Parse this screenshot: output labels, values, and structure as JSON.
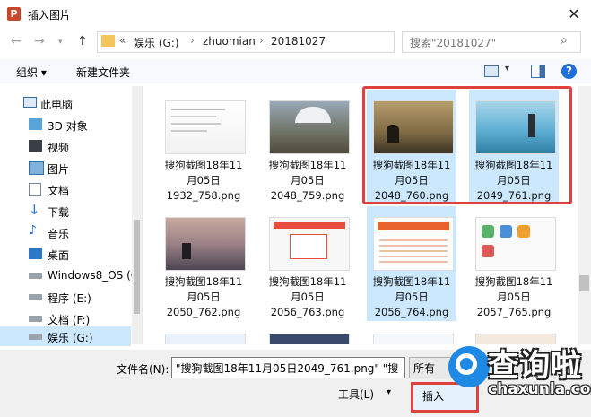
{
  "window": {
    "title": "插入图片",
    "app_icon": "P",
    "close_glyph": "✕"
  },
  "address": {
    "chevron": "«",
    "crumbs": [
      "娱乐 (G:)",
      "zhuomian",
      "20181027"
    ],
    "search_placeholder": "搜索\"20181027\""
  },
  "toolbar": {
    "organize": "组织 ▾",
    "new_folder": "新建文件夹"
  },
  "nav": {
    "items": [
      {
        "label": "此电脑",
        "icon": "computer-icon"
      },
      {
        "label": "3D 对象",
        "icon": "3d-objects-icon"
      },
      {
        "label": "视频",
        "icon": "video-icon"
      },
      {
        "label": "图片",
        "icon": "pictures-icon"
      },
      {
        "label": "文档",
        "icon": "documents-icon"
      },
      {
        "label": "下载",
        "icon": "download-icon"
      },
      {
        "label": "音乐",
        "icon": "music-icon"
      },
      {
        "label": "桌面",
        "icon": "desktop-icon"
      },
      {
        "label": "Windows8_OS (C",
        "icon": "drive-icon"
      },
      {
        "label": "程序 (E:)",
        "icon": "drive-icon"
      },
      {
        "label": "文档 (F:)",
        "icon": "drive-icon"
      },
      {
        "label": "娱乐 (G:)",
        "icon": "drive-icon"
      }
    ]
  },
  "files": [
    {
      "l1": "搜狗截图18年11",
      "l2": "月05日",
      "l3": "1932_758.png"
    },
    {
      "l1": "搜狗截图18年11",
      "l2": "月05日",
      "l3": "2048_759.png"
    },
    {
      "l1": "搜狗截图18年11",
      "l2": "月05日",
      "l3": "2048_760.png"
    },
    {
      "l1": "搜狗截图18年11",
      "l2": "月05日",
      "l3": "2049_761.png"
    },
    {
      "l1": "搜狗截图18年11",
      "l2": "月05日",
      "l3": "2050_762.png"
    },
    {
      "l1": "搜狗截图18年11",
      "l2": "月05日",
      "l3": "2056_763.png"
    },
    {
      "l1": "搜狗截图18年11",
      "l2": "月05日",
      "l3": "2056_764.png"
    },
    {
      "l1": "搜狗截图18年11",
      "l2": "月05日",
      "l3": "2057_765.png"
    }
  ],
  "bottom": {
    "filename_label": "文件名(N):",
    "filename_value": "\"搜狗截图18年11月05日2049_761.png\" \"搜",
    "filetype_value": "所有",
    "tools": "工具(L)",
    "insert": "插入"
  },
  "watermark": {
    "cn": "查询啦",
    "en": "chaxunla.com"
  }
}
